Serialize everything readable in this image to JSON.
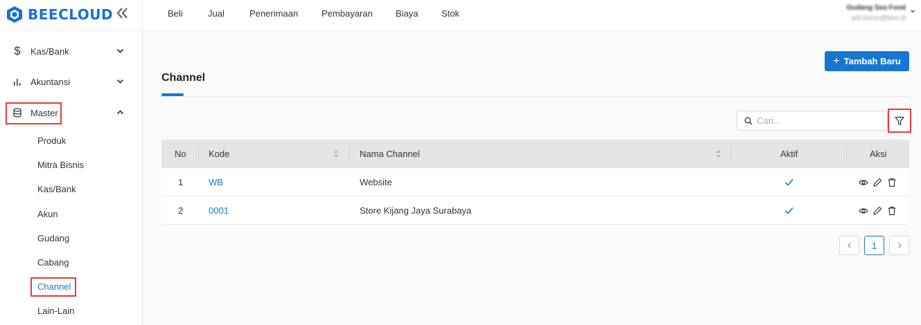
{
  "brand": {
    "name": "BEECLOUD"
  },
  "sidebar": {
    "menus": [
      {
        "label": "Kas/Bank",
        "icon": "dollar-icon"
      },
      {
        "label": "Akuntansi",
        "icon": "bar-chart-icon"
      },
      {
        "label": "Master",
        "icon": "database-icon"
      }
    ],
    "master_items": [
      "Produk",
      "Mitra Bisnis",
      "Kas/Bank",
      "Akun",
      "Gudang",
      "Cabang",
      "Channel",
      "Lain-Lain"
    ]
  },
  "topnav": [
    "Beli",
    "Jual",
    "Penerimaan",
    "Pembayaran",
    "Biaya",
    "Stok"
  ],
  "user": {
    "name": "Gudang Sea Food",
    "email": "adi.imron@bee.id"
  },
  "main": {
    "add_button": "Tambah Baru",
    "title": "Channel",
    "search_placeholder": "Cari...",
    "columns": [
      "No",
      "Kode",
      "Nama Channel",
      "Aktif",
      "Aksi"
    ],
    "rows": [
      {
        "no": "1",
        "kode": "WB",
        "nama": "Website",
        "aktif": true
      },
      {
        "no": "2",
        "kode": "0001",
        "nama": "Store Kijang Jaya Surabaya",
        "aktif": true
      }
    ],
    "pagination": {
      "current": "1"
    }
  },
  "colors": {
    "accent": "#1677d2",
    "highlight": "#e53935"
  }
}
